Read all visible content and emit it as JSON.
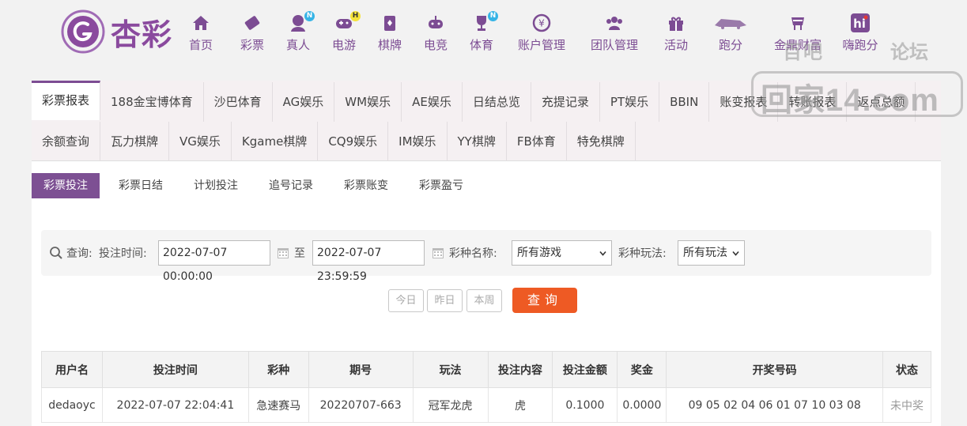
{
  "logo": {
    "text": "杏彩"
  },
  "nav": [
    {
      "label": "首页",
      "icon": "home-icon"
    },
    {
      "label": "彩票",
      "icon": "ticket-icon"
    },
    {
      "label": "真人",
      "icon": "dealer-icon",
      "badge": "N"
    },
    {
      "label": "电游",
      "icon": "gamepad-icon",
      "badge": "H"
    },
    {
      "label": "棋牌",
      "icon": "cards-icon"
    },
    {
      "label": "电竞",
      "icon": "esports-icon"
    },
    {
      "label": "体育",
      "icon": "trophy-icon",
      "badge": "N"
    },
    {
      "label": "账户管理",
      "icon": "coin-icon"
    },
    {
      "label": "团队管理",
      "icon": "team-icon"
    },
    {
      "label": "活动",
      "icon": "gift-icon"
    },
    {
      "label": "跑分",
      "icon": "racing-icon"
    },
    {
      "label": "金鼎财富",
      "icon": "ding-icon"
    },
    {
      "label": "嗨跑分",
      "icon": "hi-icon"
    }
  ],
  "watermark": {
    "top_left": "百吧",
    "top_right": "论坛",
    "main": "回家14.com"
  },
  "tabs_row1": [
    "彩票报表",
    "188金宝博体育",
    "沙巴体育",
    "AG娱乐",
    "WM娱乐",
    "AE娱乐",
    "日结总览",
    "充提记录",
    "PT娱乐",
    "BBIN",
    "账变报表",
    "转账报表",
    "返点总额"
  ],
  "tabs_row2": [
    "余额查询",
    "瓦力棋牌",
    "VG娱乐",
    "Kgame棋牌",
    "CQ9娱乐",
    "IM娱乐",
    "YY棋牌",
    "FB体育",
    "特免棋牌"
  ],
  "subtabs": [
    "彩票投注",
    "彩票日结",
    "计划投注",
    "追号记录",
    "彩票账变",
    "彩票盈亏"
  ],
  "search": {
    "query_label": "查询:",
    "time_label": "投注时间:",
    "start_time": "2022-07-07 00:00:00",
    "to_label": "至",
    "end_time": "2022-07-07 23:59:59",
    "game_label": "彩种名称:",
    "game_value": "所有游戏",
    "play_label": "彩种玩法:",
    "play_value": "所有玩法"
  },
  "quick_buttons": {
    "today": "今日",
    "yesterday": "昨日",
    "week": "本周",
    "query": "查询"
  },
  "table": {
    "headers": [
      "用户名",
      "投注时间",
      "彩种",
      "期号",
      "玩法",
      "投注内容",
      "投注金额",
      "奖金",
      "开奖号码",
      "状态"
    ],
    "rows": [
      [
        "dedaoyc",
        "2022-07-07 22:04:41",
        "急速赛马",
        "20220707-663",
        "冠军龙虎",
        "虎",
        "0.1000",
        "0.0000",
        "09 05 02 04 06 01 07 10 03 08",
        "未中奖"
      ]
    ]
  },
  "colors": {
    "brand": "#7c4c93",
    "query": "#ee5a24"
  }
}
